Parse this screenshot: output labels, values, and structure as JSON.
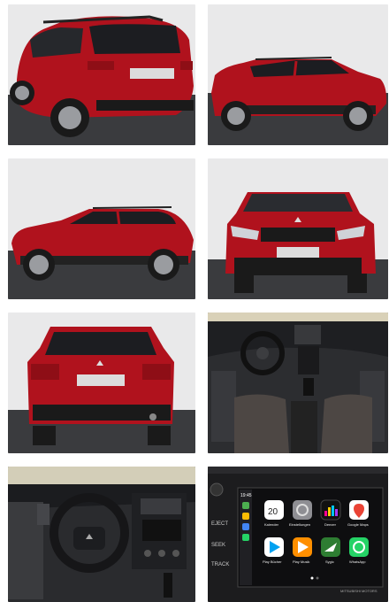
{
  "gallery": {
    "photos": [
      {
        "name": "rear-three-quarter"
      },
      {
        "name": "side-right"
      },
      {
        "name": "side-left"
      },
      {
        "name": "front"
      },
      {
        "name": "rear"
      },
      {
        "name": "interior-dashboard"
      },
      {
        "name": "steering-wheel"
      },
      {
        "name": "infotainment"
      }
    ]
  },
  "infotainment": {
    "time": "19:45",
    "side_buttons": [
      "EJECT",
      "SEEK",
      "TRACK"
    ],
    "brand": "MITSUBISHI MOTORS",
    "apps": [
      {
        "label": "Kalender",
        "value": "20",
        "color": "#ffffff"
      },
      {
        "label": "Einstellungen",
        "color": "#8e8e93"
      },
      {
        "label": "Deezer",
        "color": "#111111"
      },
      {
        "label": "Google Maps",
        "color": "#ffffff"
      },
      {
        "label": "Play Bücher",
        "color": "#ffffff"
      },
      {
        "label": "Play Musik",
        "color": "#ff8f00"
      },
      {
        "label": "Sygic",
        "color": "#2e7d32"
      },
      {
        "label": "WhatsApp",
        "color": "#25d366"
      }
    ]
  },
  "colors": {
    "car_red": "#b0121d",
    "background": "#ffffff"
  }
}
